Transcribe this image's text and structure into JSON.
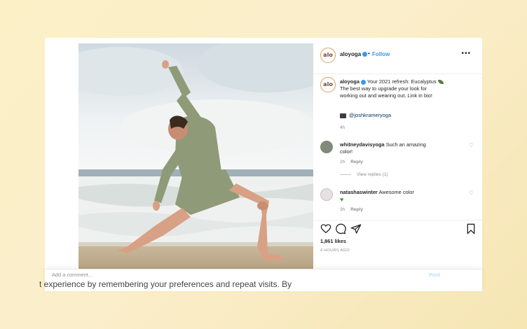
{
  "post": {
    "username": "aloyoga",
    "avatar_text": "alo",
    "dot": "•",
    "follow": "Follow",
    "more": "•••",
    "caption_user": "aloyoga",
    "caption_text": "Your 2021 refresh: Eucalyptus",
    "caption_text2": "The best way to upgrade your look for working out and wearing out. Link in bio!",
    "tag": "@joshkrameryoga",
    "caption_time": "4h"
  },
  "comments": [
    {
      "username": "whitneydavisyoga",
      "text": "Such an amazing color!",
      "time": "2h",
      "reply": "Reply",
      "view_replies": "View replies (1)"
    },
    {
      "username": "natashaswinter",
      "text": "Awesome color",
      "time": "3h",
      "reply": "Reply"
    }
  ],
  "actions": {
    "likes": "1,861 likes",
    "ago": "4 HOURS AGO",
    "add_comment": "Add a comment...",
    "post_button": "Post"
  },
  "cookie": {
    "text": "t experience by remembering your preferences and repeat visits. By"
  },
  "colors": {
    "accent": "#3897f0",
    "background": "#fbf0c6",
    "outfit": "#8f9a78"
  },
  "icons": [
    "verified-icon",
    "more-icon",
    "heart-icon",
    "comment-icon",
    "share-icon",
    "bookmark-icon",
    "leaf-icon",
    "camera-icon"
  ]
}
